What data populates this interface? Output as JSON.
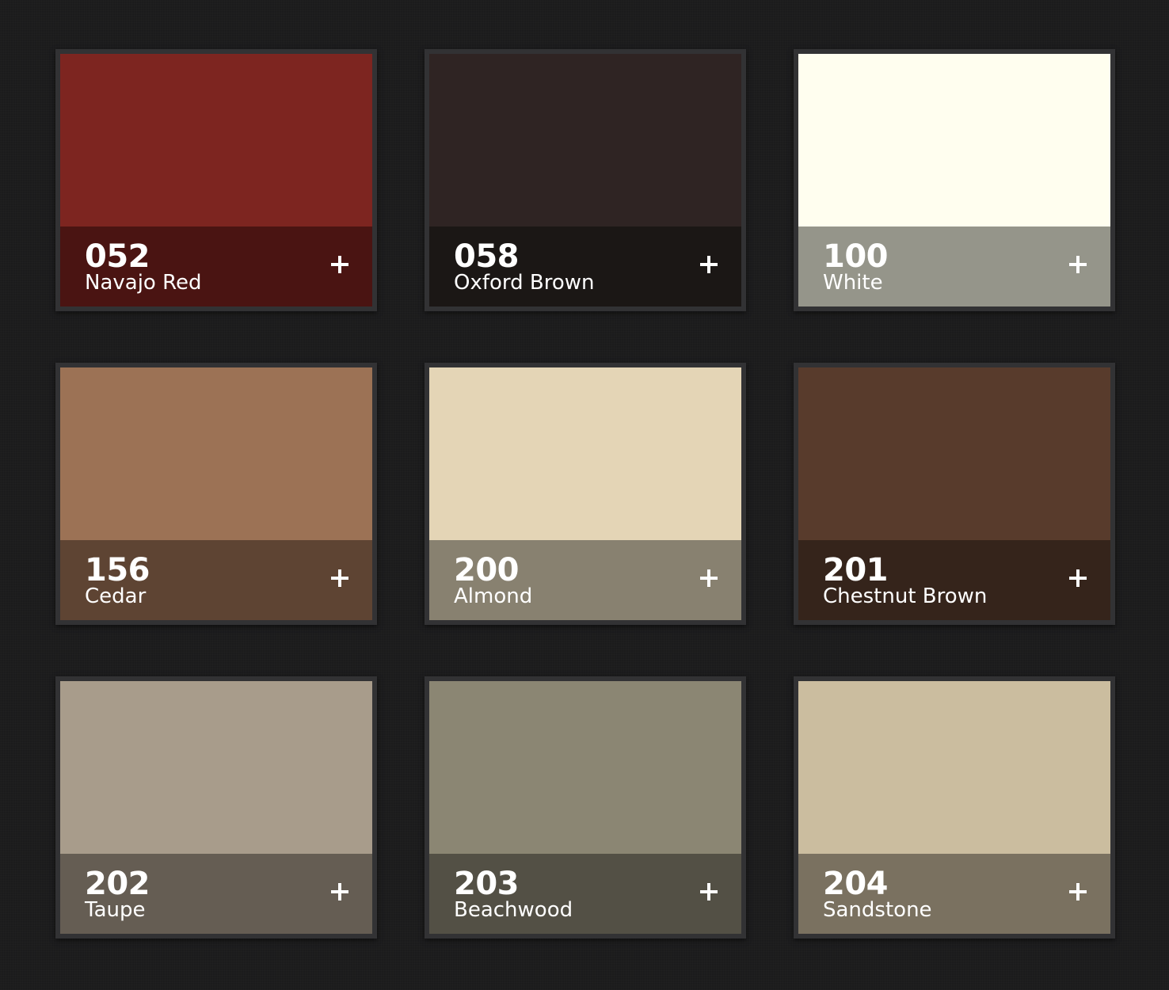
{
  "swatches": [
    {
      "code": "052",
      "name": "Navajo Red",
      "color": "#7d2520",
      "footer_color": "#4a1412"
    },
    {
      "code": "058",
      "name": "Oxford Brown",
      "color": "#2f2423",
      "footer_color": "#1b1715"
    },
    {
      "code": "100",
      "name": "White",
      "color": "#fffeef",
      "footer_color": "#95958a"
    },
    {
      "code": "156",
      "name": "Cedar",
      "color": "#9c7255",
      "footer_color": "#5e4433"
    },
    {
      "code": "200",
      "name": "Almond",
      "color": "#e4d5b6",
      "footer_color": "#888170"
    },
    {
      "code": "201",
      "name": "Chestnut Brown",
      "color": "#583b2c",
      "footer_color": "#35241b"
    },
    {
      "code": "202",
      "name": "Taupe",
      "color": "#a89c8b",
      "footer_color": "#655d53"
    },
    {
      "code": "203",
      "name": "Beachwood",
      "color": "#8b8673",
      "footer_color": "#535045"
    },
    {
      "code": "204",
      "name": "Sandstone",
      "color": "#cbbd9f",
      "footer_color": "#7a7160"
    }
  ]
}
